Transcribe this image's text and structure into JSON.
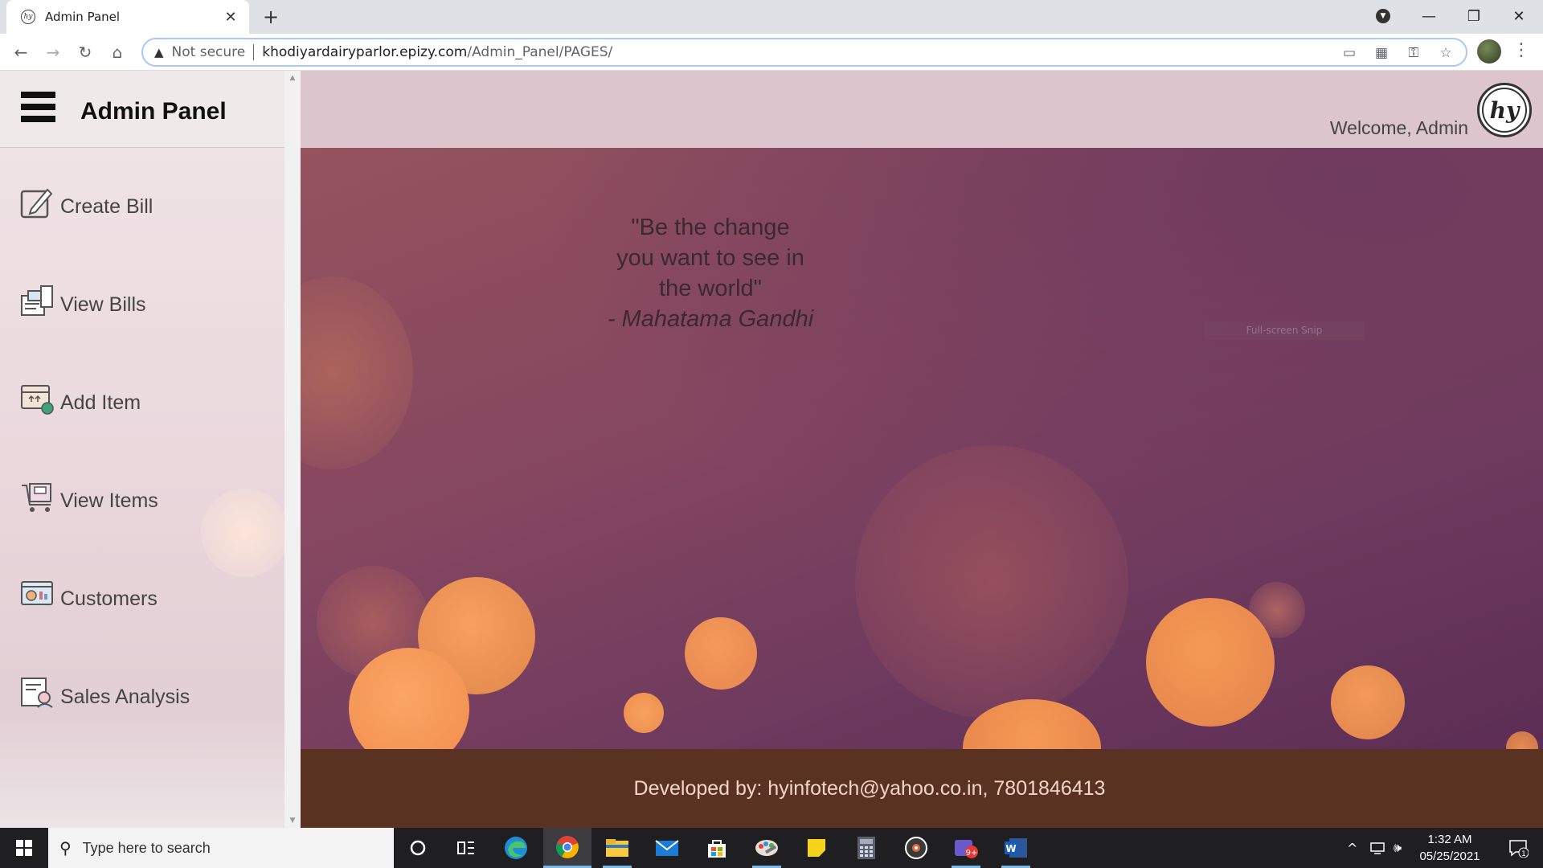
{
  "browser": {
    "tab_title": "Admin Panel",
    "favicon_text": "hy",
    "new_tab": "+",
    "address": {
      "security_label": "Not secure",
      "url_host": "khodiyardairyparlor.epizy.com",
      "url_path": "/Admin_Panel/PAGES/"
    }
  },
  "sidebar": {
    "title": "Admin Panel",
    "items": [
      {
        "label": "Create Bill",
        "icon": "create-bill-icon"
      },
      {
        "label": "View Bills",
        "icon": "view-bills-icon"
      },
      {
        "label": "Add Item",
        "icon": "add-item-icon"
      },
      {
        "label": "View Items",
        "icon": "view-items-icon"
      },
      {
        "label": "Customers",
        "icon": "customers-icon"
      },
      {
        "label": "Sales Analysis",
        "icon": "sales-analysis-icon"
      }
    ]
  },
  "header": {
    "welcome": "Welcome, Admin",
    "logo_text": "hy"
  },
  "hero": {
    "quote_lines": [
      "\"Be the change",
      "you want to see in",
      "the world\""
    ],
    "author": "- Mahatama Gandhi",
    "snip_tooltip": "Full-screen Snip"
  },
  "footer": {
    "text": "Developed by: hyinfotech@yahoo.co.in, 7801846413"
  },
  "taskbar": {
    "search_placeholder": "Type here to search",
    "time": "1:32 AM",
    "date": "05/25/2021",
    "notification_count": "1",
    "mail_badge": "9+"
  },
  "colors": {
    "sidebar_bg": "#ead8dd",
    "header_bg": "#dcc5cc",
    "hero_bg": "#854660",
    "footer_bg": "#5a3222",
    "bokeh": "#f59a55",
    "taskbar_bg": "#1f1f22"
  }
}
